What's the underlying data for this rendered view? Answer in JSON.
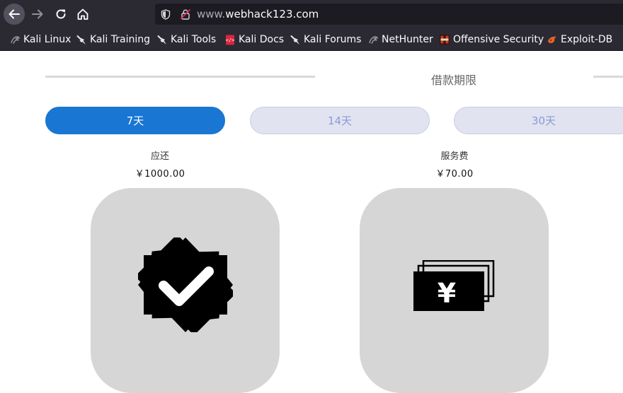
{
  "browser": {
    "url_prefix": "www.",
    "url_domain": "webhack123.com",
    "nav_icons": [
      "arrow-left-icon",
      "arrow-right-icon",
      "reload-icon",
      "home-icon"
    ],
    "bookmarks": [
      {
        "label": "Kali Linux",
        "icon": "kali-dragon-icon"
      },
      {
        "label": "Kali Training",
        "icon": "kali-dragon-icon"
      },
      {
        "label": "Kali Tools",
        "icon": "kali-dragon-icon"
      },
      {
        "label": "Kali Docs",
        "icon": "kali-docs-icon"
      },
      {
        "label": "Kali Forums",
        "icon": "kali-dragon-icon"
      },
      {
        "label": "NetHunter",
        "icon": "nethunter-icon"
      },
      {
        "label": "Offensive Security",
        "icon": "offsec-icon"
      },
      {
        "label": "Exploit-DB",
        "icon": "exploit-db-icon"
      }
    ]
  },
  "loan": {
    "section_title": "借款期限",
    "terms": [
      {
        "label": "7天",
        "selected": true
      },
      {
        "label": "14天",
        "selected": false
      },
      {
        "label": "30天",
        "selected": false
      }
    ],
    "repay_label": "应还",
    "repay_value": "￥1000.00",
    "fee_label": "服务费",
    "fee_value": "￥70.00",
    "cards": [
      {
        "icon": "verified-badge-icon"
      },
      {
        "icon": "yen-banknotes-icon"
      }
    ]
  },
  "colors": {
    "accent": "#1976d2",
    "inactive_button_bg": "#e1e3f0",
    "inactive_button_text": "#8c9ad6",
    "card_bg": "#d6d6d6",
    "chrome_bg": "#2b2a33"
  }
}
